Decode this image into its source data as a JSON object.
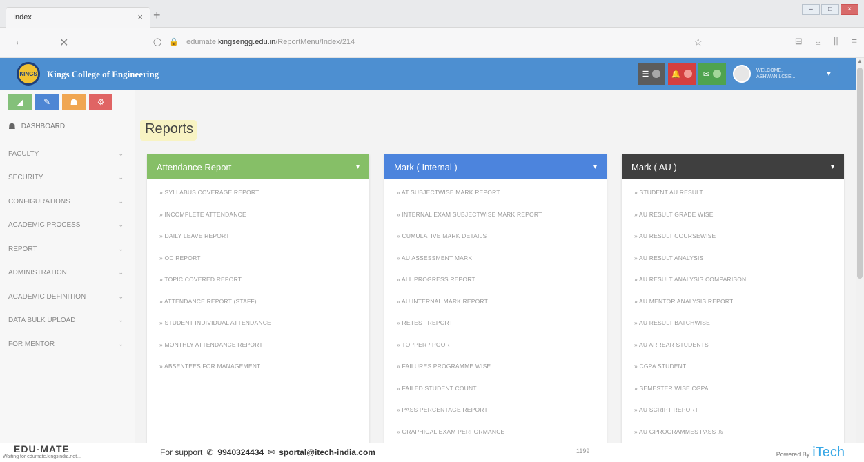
{
  "browser": {
    "tab_title": "Index",
    "tab_close": "×",
    "new_tab": "+",
    "url_prefix": "edumate.",
    "url_host": "kingsengg.edu.in",
    "url_path": "/ReportMenu/Index/214",
    "status_text": "Waiting for edumate.kingsindia.net..."
  },
  "app": {
    "title": "Kings College of Engineering",
    "logo_text": "KINGS",
    "user_welcome": "WELCOME,",
    "user_name": "ASHWANILCSE..."
  },
  "sidebar": {
    "dashboard_label": "DASHBOARD",
    "items": [
      {
        "label": "FACULTY"
      },
      {
        "label": "SECURITY"
      },
      {
        "label": "CONFIGURATIONS"
      },
      {
        "label": "ACADEMIC PROCESS"
      },
      {
        "label": "REPORT"
      },
      {
        "label": "ADMINISTRATION"
      },
      {
        "label": "ACADEMIC DEFINITION"
      },
      {
        "label": "DATA BULK UPLOAD"
      },
      {
        "label": "FOR MENTOR"
      }
    ]
  },
  "page": {
    "title": "Reports"
  },
  "panels": [
    {
      "title": "Attendance Report",
      "color": "#86bf67",
      "links": [
        "» SYLLABUS COVERAGE REPORT",
        "» INCOMPLETE ATTENDANCE",
        "» DAILY LEAVE REPORT",
        "» OD REPORT",
        "» TOPIC COVERED REPORT",
        "» ATTENDANCE REPORT (STAFF)",
        "» STUDENT INDIVIDUAL ATTENDANCE",
        "» MONTHLY ATTENDANCE REPORT",
        "» ABSENTEES FOR MANAGEMENT"
      ]
    },
    {
      "title": "Mark ( Internal )",
      "color": "#4c84dd",
      "links": [
        "» AT SUBJECTWISE MARK REPORT",
        "» INTERNAL EXAM SUBJECTWISE MARK REPORT",
        "» CUMULATIVE MARK DETAILS",
        "» AU ASSESSMENT MARK",
        "» ALL PROGRESS REPORT",
        "» AU INTERNAL MARK REPORT",
        "» RETEST REPORT",
        "» TOPPER / POOR",
        "» FAILURES PROGRAMME WISE",
        "» FAILED STUDENT COUNT",
        "» PASS PERCENTAGE REPORT",
        "» GRAPHICAL EXAM PERFORMANCE"
      ]
    },
    {
      "title": "Mark ( AU )",
      "color": "#3f3f3f",
      "links": [
        "» STUDENT AU RESULT",
        "» AU RESULT GRADE WISE",
        "» AU RESULT COURSEWISE",
        "» AU RESULT ANALYSIS",
        "» AU RESULT ANALYSIS COMPARISON",
        "» AU MENTOR ANALYSIS REPORT",
        "» AU RESULT BATCHWISE",
        "» AU ARREAR STUDENTS",
        "» CGPA STUDENT",
        "» SEMESTER WISE CGPA",
        "» AU SCRIPT REPORT",
        "» AU GPROGRAMMES PASS %"
      ]
    }
  ],
  "footer": {
    "brand": "EDU-MATE",
    "support_label": "For support",
    "phone": "9940324434",
    "email": "sportal@itech-india.com",
    "counter": "1199",
    "powered_by": "Powered By",
    "itech": "iTech"
  }
}
